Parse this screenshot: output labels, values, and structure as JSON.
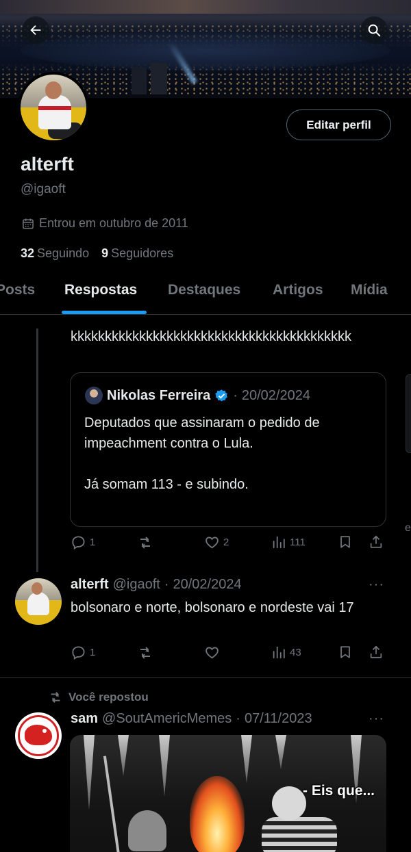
{
  "profile": {
    "display_name": "alterft",
    "handle": "@igaoft",
    "joined": "Entrou em outubro de 2011",
    "following_count": "32",
    "following_label": "Seguindo",
    "followers_count": "9",
    "followers_label": "Seguidores",
    "edit_button": "Editar perfil"
  },
  "header": {
    "back_icon": "arrow-left-icon",
    "search_icon": "search-icon"
  },
  "tabs": [
    {
      "label": "Posts",
      "active": false
    },
    {
      "label": "Respostas",
      "active": true
    },
    {
      "label": "Destaques",
      "active": false
    },
    {
      "label": "Artigos",
      "active": false
    },
    {
      "label": "Mídia",
      "active": false
    }
  ],
  "tweets": [
    {
      "text": "kkkkkkkkkkkkkkkkkkkkkkkkkkkkkkkkkkkkkkkkk",
      "quote": {
        "name": "Nikolas Ferreira",
        "separator": "·",
        "date": "20/02/2024",
        "verified": true,
        "paragraphs": [
          "Deputados que assinaram o pedido de impeachment contra o Lula.",
          "Já somam 113 - e subindo."
        ]
      },
      "replies": "1",
      "reposts": "",
      "likes": "2",
      "views": "111"
    },
    {
      "name": "alterft",
      "handle": "@igaoft",
      "separator": "·",
      "date": "20/02/2024",
      "more": "···",
      "text": "bolsonaro e norte, bolsonaro e nordeste vai 17",
      "replies": "1",
      "reposts": "",
      "likes": "",
      "views": "43"
    },
    {
      "repost_label": "Você repostou",
      "name": "sam",
      "handle": "@SoutAmericMemes",
      "separator": "·",
      "date": "07/11/2023",
      "more": "···",
      "media_caption": "- Eis que..."
    }
  ],
  "side_peek": {
    "text": "e"
  },
  "colors": {
    "background": "#000000",
    "text": "#e7e9ea",
    "muted": "#71767b",
    "accent": "#1d9bf0",
    "border": "#2f3336"
  }
}
